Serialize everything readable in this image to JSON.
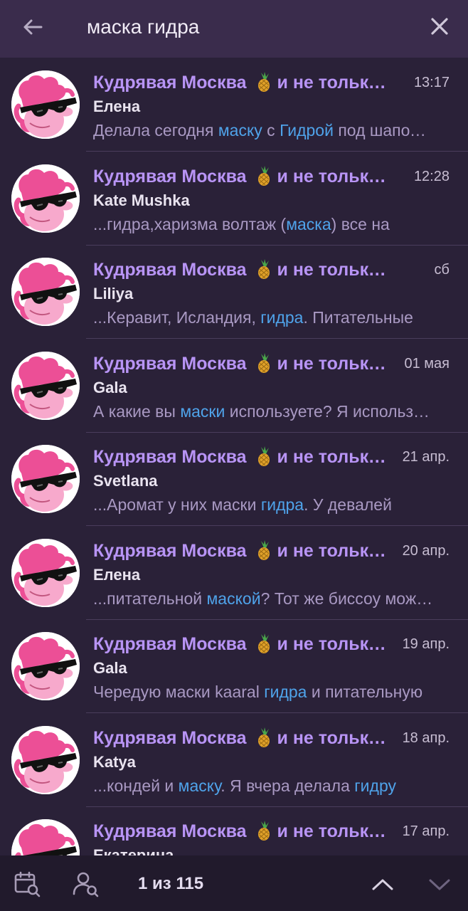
{
  "search": {
    "query": "маска гидра"
  },
  "results": [
    {
      "chat": "Кудрявая Москва 🍍 и не только ;)",
      "time": "13:17",
      "sender": "Елена",
      "snippet": [
        {
          "t": "Делала сегодня "
        },
        {
          "t": "маску",
          "h": true
        },
        {
          "t": " с "
        },
        {
          "t": "Гидрой",
          "h": true
        },
        {
          "t": " под шапочкой"
        }
      ]
    },
    {
      "chat": "Кудрявая Москва 🍍 и не только ;)",
      "time": "12:28",
      "sender": "Kate Mushka",
      "snippet": [
        {
          "t": "...гидра,харизма волтаж ("
        },
        {
          "t": "маска",
          "h": true
        },
        {
          "t": ") все на"
        }
      ]
    },
    {
      "chat": "Кудрявая Москва 🍍 и не только ;)",
      "time": "сб",
      "sender": "Liliya",
      "snippet": [
        {
          "t": "...Керавит, Исландия, "
        },
        {
          "t": "гидра",
          "h": true
        },
        {
          "t": ". Питательные"
        }
      ]
    },
    {
      "chat": "Кудрявая Москва 🍍 и не только ;)",
      "time": "01 мая",
      "sender": "Gala",
      "snippet": [
        {
          "t": "А какие вы "
        },
        {
          "t": "маски",
          "h": true
        },
        {
          "t": " используете? Я использую"
        }
      ]
    },
    {
      "chat": "Кудрявая Москва 🍍 и не только ;)",
      "time": "21 апр.",
      "sender": "Svetlana",
      "snippet": [
        {
          "t": "...Аромат у них маски "
        },
        {
          "t": "гидра",
          "h": true
        },
        {
          "t": ". У девалей"
        }
      ]
    },
    {
      "chat": "Кудрявая Москва 🍍 и не только ;)",
      "time": "20 апр.",
      "sender": "Елена",
      "snippet": [
        {
          "t": "...питательной "
        },
        {
          "t": "маской",
          "h": true
        },
        {
          "t": "? Тот же биссоу можно"
        }
      ]
    },
    {
      "chat": "Кудрявая Москва 🍍 и не только ;)",
      "time": "19 апр.",
      "sender": "Gala",
      "snippet": [
        {
          "t": "Чередую маски kaaral "
        },
        {
          "t": "гидра",
          "h": true
        },
        {
          "t": " и питательную"
        }
      ]
    },
    {
      "chat": "Кудрявая Москва 🍍 и не только ;)",
      "time": "18 апр.",
      "sender": "Katya",
      "snippet": [
        {
          "t": "...кондей и "
        },
        {
          "t": "маску",
          "h": true
        },
        {
          "t": ". Я вчера делала "
        },
        {
          "t": "гидру",
          "h": true
        }
      ]
    },
    {
      "chat": "Кудрявая Москва 🍍 и не только ;)",
      "time": "17 апр.",
      "sender": "Екатерина",
      "snippet": [
        {
          "t": ""
        }
      ]
    }
  ],
  "bottom": {
    "counter": "1 из 115"
  },
  "colors": {
    "title": "#b894f5",
    "highlight": "#4fa3ea",
    "background": "#2a2138"
  },
  "icons": [
    "back-arrow-icon",
    "close-icon",
    "calendar-search-icon",
    "user-search-icon",
    "chevron-up-icon",
    "chevron-down-icon"
  ]
}
